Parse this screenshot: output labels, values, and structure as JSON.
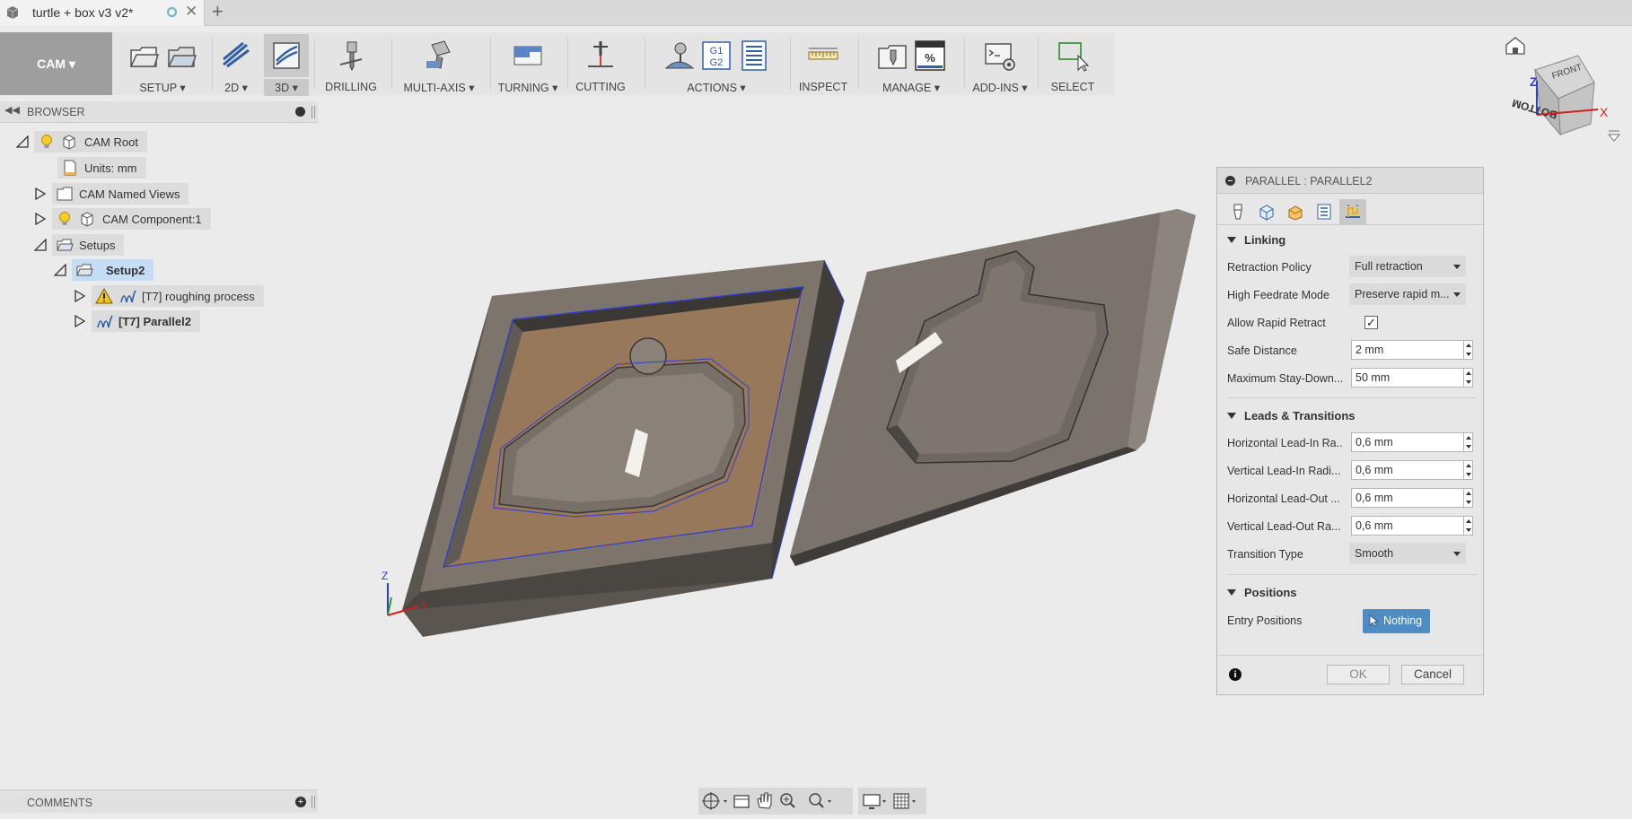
{
  "document": {
    "title": "turtle + box v3 v2*"
  },
  "workspace": {
    "label": "CAM"
  },
  "toolbar": {
    "groups": [
      {
        "id": "setup",
        "label": "SETUP",
        "dropdown": true
      },
      {
        "id": "2d",
        "label": "2D",
        "dropdown": true
      },
      {
        "id": "3d",
        "label": "3D",
        "dropdown": true,
        "selected": true
      },
      {
        "id": "drilling",
        "label": "DRILLING",
        "dropdown": false
      },
      {
        "id": "multiaxis",
        "label": "MULTI-AXIS",
        "dropdown": true
      },
      {
        "id": "turning",
        "label": "TURNING",
        "dropdown": true
      },
      {
        "id": "cutting",
        "label": "CUTTING",
        "dropdown": false
      },
      {
        "id": "actions",
        "label": "ACTIONS",
        "dropdown": true
      },
      {
        "id": "inspect",
        "label": "INSPECT",
        "dropdown": false
      },
      {
        "id": "manage",
        "label": "MANAGE",
        "dropdown": true
      },
      {
        "id": "addins",
        "label": "ADD-INS",
        "dropdown": true
      },
      {
        "id": "select",
        "label": "SELECT",
        "dropdown": false
      }
    ],
    "gcode_icon_text": [
      "G1",
      "G2"
    ],
    "manage_icon_text": "%"
  },
  "browser": {
    "title": "BROWSER",
    "tree": [
      {
        "label": "CAM Root",
        "icon": "lightbulb-icon"
      },
      {
        "label": "Units: mm",
        "icon": "document-icon"
      },
      {
        "label": "CAM Named Views",
        "icon": "folder-icon"
      },
      {
        "label": "CAM Component:1",
        "icon": "lightbulb-icon"
      },
      {
        "label": "Setups",
        "icon": "setup-folder-icon"
      },
      {
        "label": "Setup2",
        "icon": "setup-folder-icon"
      },
      {
        "label": "[T7] roughing process",
        "icon": "toolpath-icon",
        "warning": true
      },
      {
        "label": "[T7] Parallel2",
        "icon": "toolpath-icon"
      }
    ]
  },
  "comments": {
    "title": "COMMENTS"
  },
  "viewcube": {
    "top": "FRONT",
    "face": "BOTTOM",
    "axis_x": "X",
    "axis_z": "Z"
  },
  "triad": {
    "x": "X",
    "y": "Y",
    "z": "Z"
  },
  "dialog": {
    "title": "PARALLEL : PARALLEL2",
    "sections": {
      "linking": "Linking",
      "leads": "Leads & Transitions",
      "positions": "Positions"
    },
    "fields": {
      "retraction_policy": {
        "label": "Retraction Policy",
        "value": "Full retraction"
      },
      "high_feedrate_mode": {
        "label": "High Feedrate Mode",
        "value": "Preserve rapid m..."
      },
      "allow_rapid_retract": {
        "label": "Allow Rapid Retract",
        "checked": "✓"
      },
      "safe_distance": {
        "label": "Safe Distance",
        "value": "2 mm"
      },
      "max_stay_down": {
        "label": "Maximum Stay-Down...",
        "value": "50 mm"
      },
      "h_lead_in": {
        "label": "Horizontal Lead-In Ra...",
        "value": "0,6 mm"
      },
      "v_lead_in": {
        "label": "Vertical Lead-In Radi...",
        "value": "0,6 mm"
      },
      "h_lead_out": {
        "label": "Horizontal Lead-Out ...",
        "value": "0,6 mm"
      },
      "v_lead_out": {
        "label": "Vertical Lead-Out Ra...",
        "value": "0,6 mm"
      },
      "transition_type": {
        "label": "Transition Type",
        "value": "Smooth"
      },
      "entry_positions": {
        "label": "Entry Positions",
        "value": "Nothing"
      }
    },
    "buttons": {
      "ok": "OK",
      "cancel": "Cancel"
    }
  },
  "colors": {
    "selection_blue": "#4f8cc4",
    "tree_selected": "#c5dcf5",
    "toolpath_blue": "#2b3fd6",
    "stock_orange": "#a08060",
    "model_grey": "#6f6a63"
  }
}
